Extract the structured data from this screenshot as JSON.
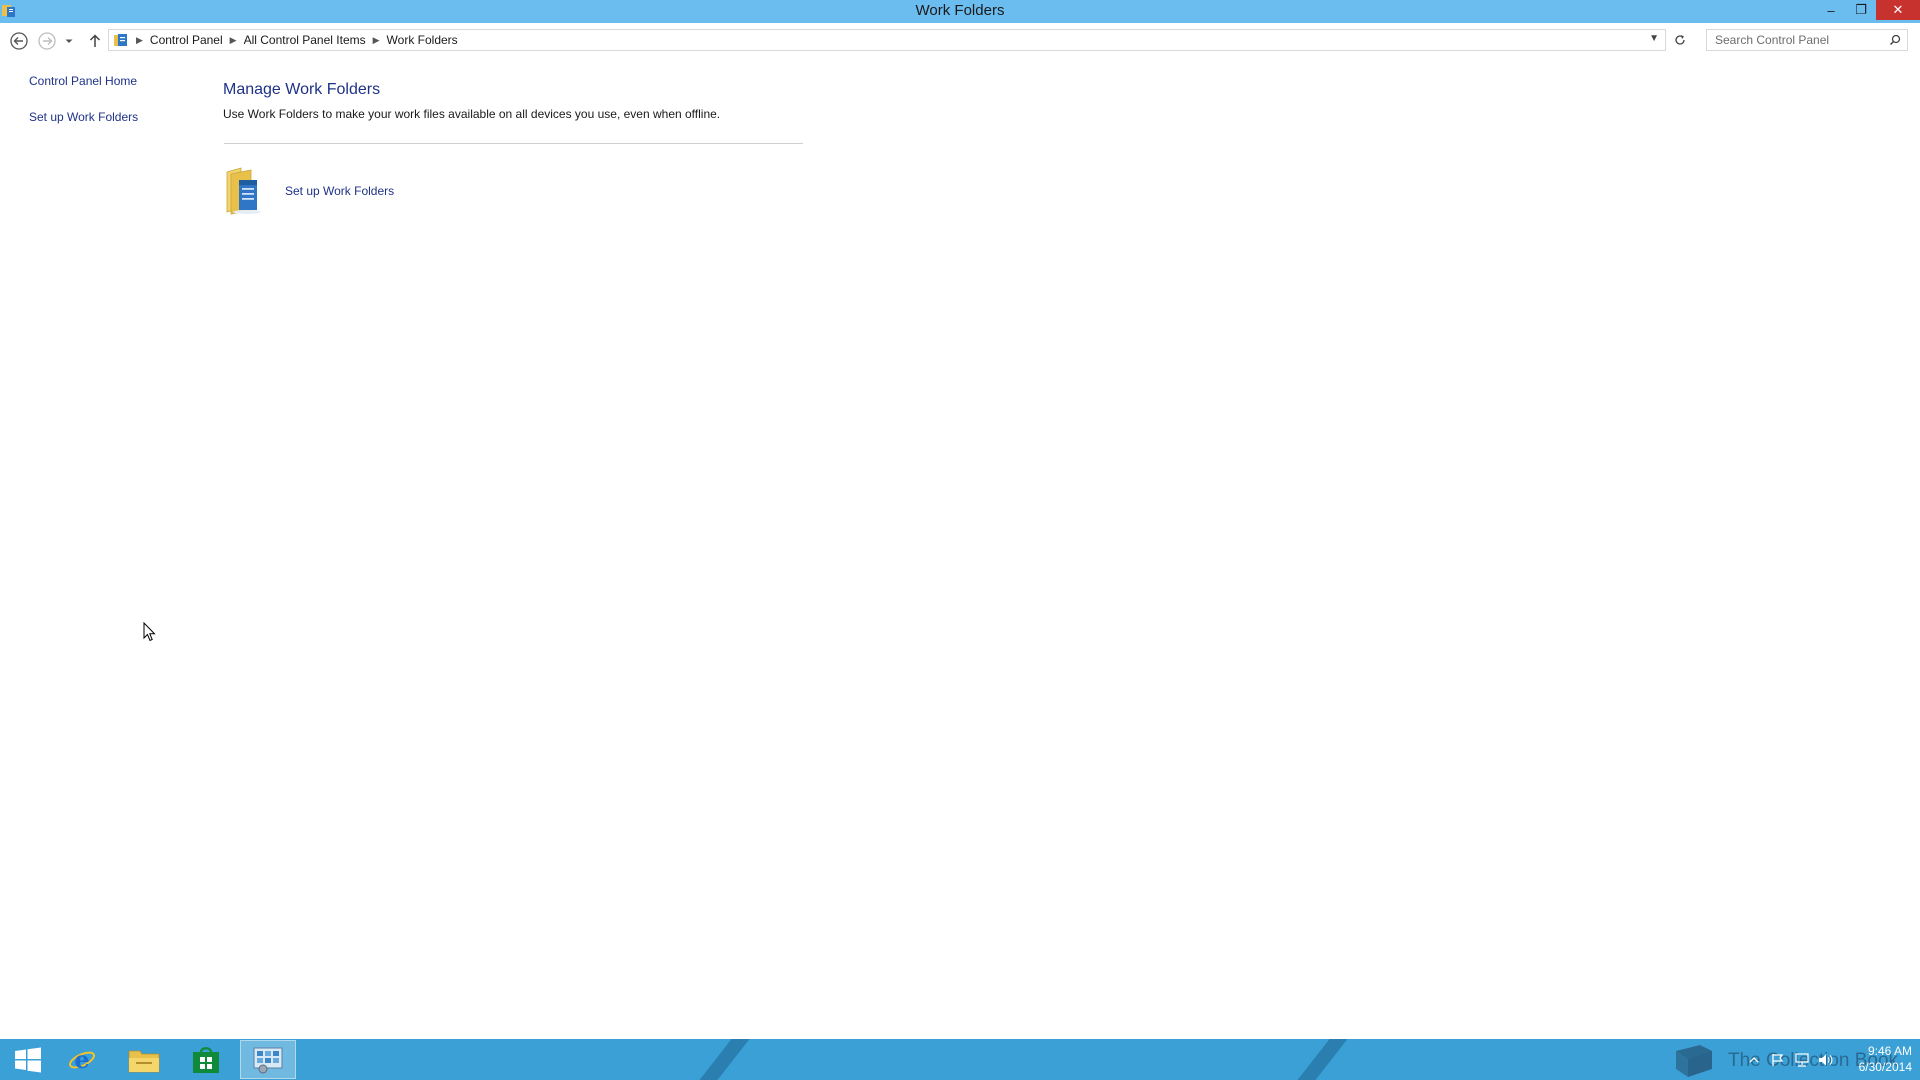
{
  "window": {
    "title": "Work Folders",
    "minimize_glyph": "–",
    "maximize_glyph": "❐",
    "close_glyph": "✕"
  },
  "address": {
    "breadcrumbs": [
      {
        "label": "Control Panel"
      },
      {
        "label": "All Control Panel Items"
      },
      {
        "label": "Work Folders"
      }
    ]
  },
  "search": {
    "placeholder": "Search Control Panel"
  },
  "left_pane": {
    "links": [
      {
        "label": "Control Panel Home"
      },
      {
        "label": "Set up Work Folders"
      }
    ]
  },
  "main": {
    "heading": "Manage Work Folders",
    "description": "Use Work Folders to make your work files available on all devices you use, even when offline.",
    "task_link": "Set up Work Folders"
  },
  "taskbar": {
    "watermark": "The Collection Book",
    "clock": {
      "time": "9:46 AM",
      "date": "6/30/2014"
    }
  },
  "colors": {
    "titlebar": "#6bbdf0",
    "taskbar": "#3aa0d6",
    "link": "#1e3287",
    "close_button": "#c7312e"
  },
  "icons": {
    "app": "work-folders-icon",
    "back": "arrow-left-circle-icon",
    "forward": "arrow-right-circle-icon",
    "recent": "chevron-down-icon",
    "up": "arrow-up-icon",
    "refresh": "refresh-icon",
    "search": "magnifier-icon"
  }
}
